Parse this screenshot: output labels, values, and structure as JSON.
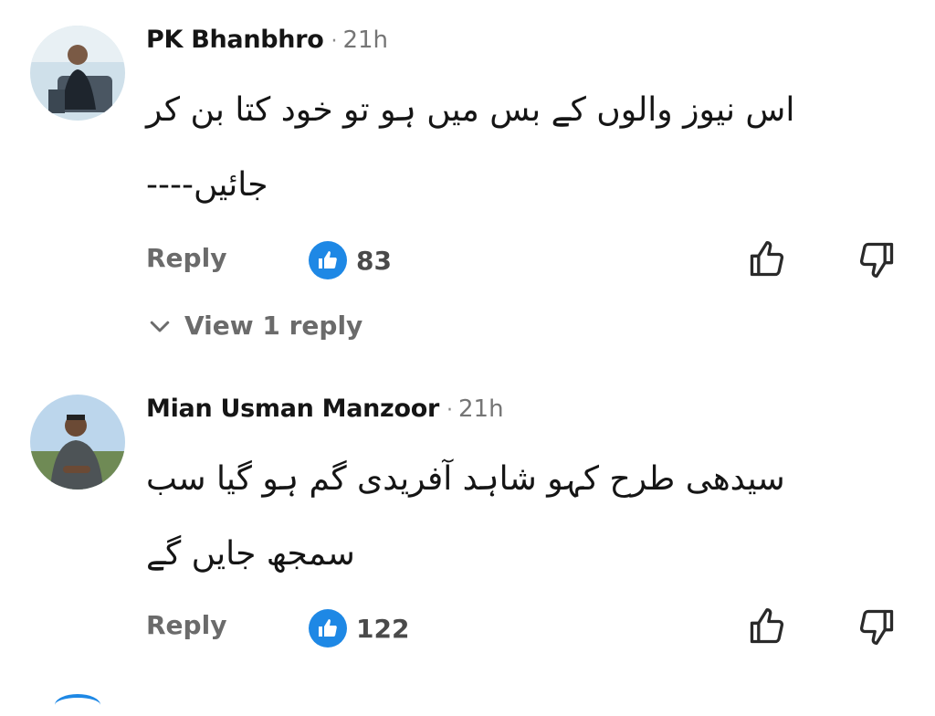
{
  "comments": [
    {
      "author": "PK Bhanbhro",
      "separator": "·",
      "time": "21h",
      "text": "اس نیوز والوں کے بس میں ہو تو خود کتا بن کر جائیں----",
      "reply_label": "Reply",
      "likes": "83",
      "view_replies": "View 1 reply"
    },
    {
      "author": "Mian Usman Manzoor",
      "separator": "·",
      "time": "21h",
      "text": "سیدھی طرح کہو شاہد آفریدی گم ہو گیا سب سمجھ جایں گے",
      "reply_label": "Reply",
      "likes": "122"
    }
  ],
  "icons": {
    "like": "thumbs-up-outline-icon",
    "dislike": "thumbs-down-outline-icon",
    "like_badge": "thumbs-up-filled-badge-icon",
    "expand": "chevron-down-icon"
  },
  "colors": {
    "like_badge": "#1e88e5",
    "text": "#151515",
    "muted": "#6b6b6b"
  }
}
